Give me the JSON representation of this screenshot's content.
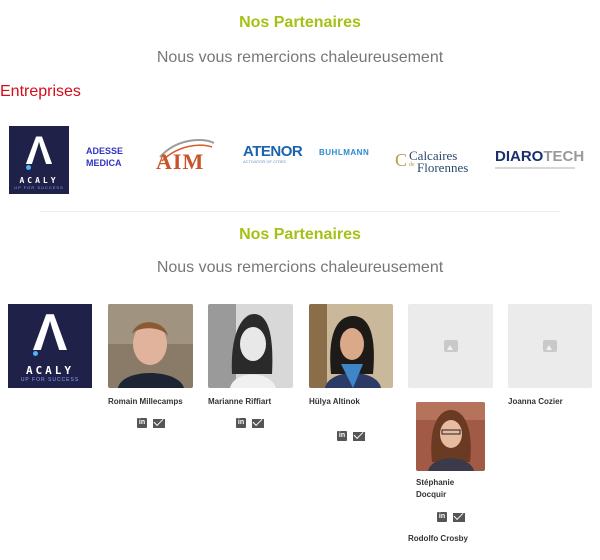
{
  "section1": {
    "title": "Nos Partenaires",
    "subtitle": "Nous vous remercions chaleureusement",
    "category": "Entreprises",
    "logos": [
      {
        "name": "ACALY",
        "tagline": "UP FOR SUCCESS"
      },
      {
        "line1": "ADESSE",
        "line2": "MEDICA"
      },
      {
        "name": "AIM"
      },
      {
        "name": "ATENOR",
        "tagline": "ACTIVATOR OF CITIES"
      },
      {
        "name": "BUHLMANN"
      },
      {
        "line1": "Calcaires",
        "line2": "Florennes",
        "mark": "de"
      },
      {
        "name1": "DIARO",
        "name2": "TECH"
      }
    ]
  },
  "section2": {
    "title": "Nos Partenaires",
    "subtitle": "Nous vous remercions chaleureusement",
    "people": [
      {
        "name": "Romain Millecamps"
      },
      {
        "name": "Marianne Riffiart"
      },
      {
        "name": "Hülya Altinok"
      },
      {
        "name": "Joanna Cozier"
      },
      {
        "name": "Stéphanie Docquir"
      },
      {
        "name": "Rodolfo Crosby"
      }
    ],
    "social": {
      "linkedin": "in"
    }
  },
  "colors": {
    "accent": "#a4c116",
    "red": "#d10d1c",
    "subtitle": "#777777",
    "acaly_bg": "#1f2148"
  }
}
